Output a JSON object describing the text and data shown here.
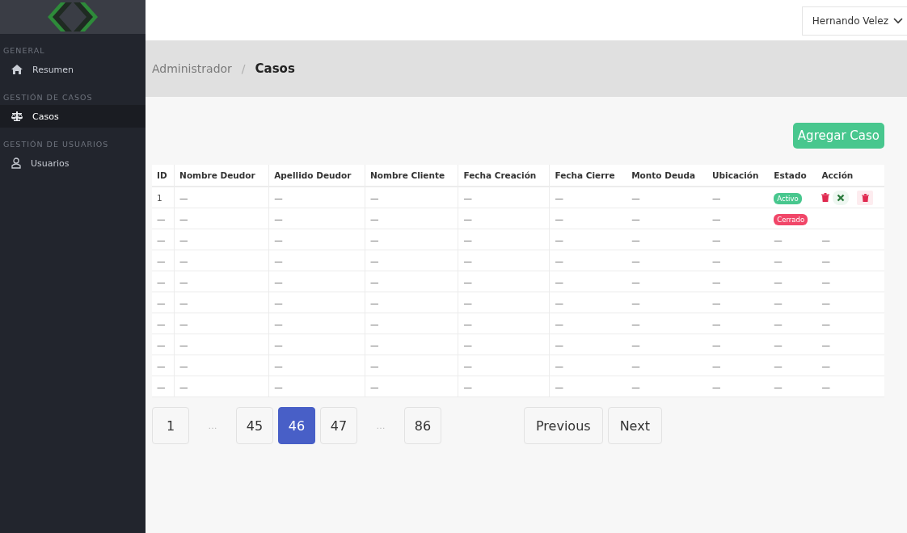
{
  "sidebar": {
    "groups": [
      {
        "header": "GENERAL",
        "items": [
          {
            "label": "Resumen",
            "selected": false
          }
        ]
      },
      {
        "header": "GESTIÓN DE CASOS",
        "items": [
          {
            "label": "Casos",
            "selected": true
          }
        ]
      },
      {
        "header": "GESTIÓN DE USUARIOS",
        "items": [
          {
            "label": "Usuarios",
            "selected": false
          }
        ]
      }
    ]
  },
  "user_menu": {
    "label": "Hernando Velez"
  },
  "breadcrumb": [
    "Administrador",
    "/",
    "Casos"
  ],
  "add_button": "Agregar Caso",
  "table": {
    "columns": [
      "ID",
      "Nombre Deudor",
      "Apellido Deudor",
      "Nombre Cliente",
      "Fecha Creación",
      "Fecha Cierre",
      "Monto Deuda",
      "Ubicación",
      "Estado",
      "Acción"
    ],
    "rows": [
      {
        "cells": [
          "1",
          "—",
          "—",
          "—",
          "—",
          "—",
          "—",
          "—"
        ],
        "estado": {
          "kind": "badge",
          "label": "Activo",
          "color": "#48c78e"
        },
        "accion": {
          "kind": "icons",
          "icons": [
            {
              "kind": "trash"
            },
            {
              "kind": "close"
            },
            {
              "kind": "boxed-trash"
            }
          ]
        }
      },
      {
        "cells": [
          "—",
          "—",
          "—",
          "—",
          "—",
          "—",
          "—",
          "—"
        ],
        "estado": {
          "kind": "badge",
          "label": "Cerrado",
          "color": "#f14668"
        },
        "accion": {
          "kind": "none"
        }
      },
      {
        "cells": [
          "—",
          "—",
          "—",
          "—",
          "—",
          "—",
          "—",
          "—"
        ],
        "estado": {
          "kind": "text",
          "label": "—"
        },
        "accion": {
          "kind": "text",
          "label": "—"
        }
      },
      {
        "cells": [
          "—",
          "—",
          "—",
          "—",
          "—",
          "—",
          "—",
          "—"
        ],
        "estado": {
          "kind": "text",
          "label": "—"
        },
        "accion": {
          "kind": "text",
          "label": "—"
        }
      },
      {
        "cells": [
          "—",
          "—",
          "—",
          "—",
          "—",
          "—",
          "—",
          "—"
        ],
        "estado": {
          "kind": "text",
          "label": "—"
        },
        "accion": {
          "kind": "text",
          "label": "—"
        }
      },
      {
        "cells": [
          "—",
          "—",
          "—",
          "—",
          "—",
          "—",
          "—",
          "—"
        ],
        "estado": {
          "kind": "text",
          "label": "—"
        },
        "accion": {
          "kind": "text",
          "label": "—"
        }
      },
      {
        "cells": [
          "—",
          "—",
          "—",
          "—",
          "—",
          "—",
          "—",
          "—"
        ],
        "estado": {
          "kind": "text",
          "label": "—"
        },
        "accion": {
          "kind": "text",
          "label": "—"
        }
      },
      {
        "cells": [
          "—",
          "—",
          "—",
          "—",
          "—",
          "—",
          "—",
          "—"
        ],
        "estado": {
          "kind": "text",
          "label": "—"
        },
        "accion": {
          "kind": "text",
          "label": "—"
        }
      },
      {
        "cells": [
          "—",
          "—",
          "—",
          "—",
          "—",
          "—",
          "—",
          "—"
        ],
        "estado": {
          "kind": "text",
          "label": "—"
        },
        "accion": {
          "kind": "text",
          "label": "—"
        }
      },
      {
        "cells": [
          "—",
          "—",
          "—",
          "—",
          "—",
          "—",
          "—",
          "—"
        ],
        "estado": {
          "kind": "text",
          "label": "—"
        },
        "accion": {
          "kind": "text",
          "label": "—"
        }
      }
    ]
  },
  "pagination": {
    "pages": [
      {
        "kind": "page",
        "label": "1",
        "selected": false
      },
      {
        "kind": "ellipsis",
        "label": "…"
      },
      {
        "kind": "page",
        "label": "45",
        "selected": false
      },
      {
        "kind": "page",
        "label": "46",
        "selected": true
      },
      {
        "kind": "page",
        "label": "47",
        "selected": false
      },
      {
        "kind": "ellipsis",
        "label": "…"
      },
      {
        "kind": "page",
        "label": "86",
        "selected": false
      }
    ],
    "previous": "Previous",
    "next": "Next"
  }
}
